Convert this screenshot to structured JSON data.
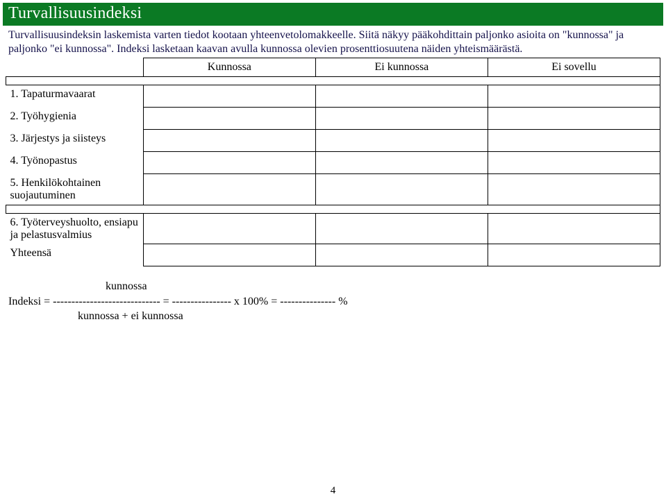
{
  "title": "Turvallisuusindeksi",
  "intro": "Turvallisuusindeksin laskemista varten tiedot kootaan yhteenvetolomakkeelle. Siitä näkyy pääkohdittain paljonko asioita on \"kunnossa\" ja paljonko \"ei kunnossa\". Indeksi lasketaan kaavan avulla kunnossa olevien prosenttiosuutena näiden yhteismäärästä.",
  "columns": {
    "col1": "Kunnossa",
    "col2": "Ei kunnossa",
    "col3": "Ei sovellu"
  },
  "rows": [
    {
      "label": "1. Tapaturmavaarat",
      "c1": "",
      "c2": "",
      "c3": ""
    },
    {
      "label": "2. Työhygienia",
      "c1": "",
      "c2": "",
      "c3": ""
    },
    {
      "label": "3. Järjestys ja siisteys",
      "c1": "",
      "c2": "",
      "c3": ""
    },
    {
      "label": "4. Työnopastus",
      "c1": "",
      "c2": "",
      "c3": ""
    },
    {
      "label": "5. Henkilökohtainen suojautuminen",
      "c1": "",
      "c2": "",
      "c3": ""
    }
  ],
  "rows2": [
    {
      "label": "6. Työterveyshuolto, ensiapu ja pelastusvalmius",
      "c1": "",
      "c2": "",
      "c3": ""
    },
    {
      "label": "Yhteensä",
      "c1": "",
      "c2": "",
      "c3": ""
    }
  ],
  "formula": {
    "num_label": "kunnossa",
    "prefix": "Indeksi = ",
    "dash_frac": "-----------------------------",
    "eq1": "   =  ",
    "dash_val": "----------------",
    "times": "  x  100%    =  ",
    "dash_res": "---------------",
    "pct": " %",
    "den_label": "kunnossa + ei kunnossa"
  },
  "page_number": "4"
}
